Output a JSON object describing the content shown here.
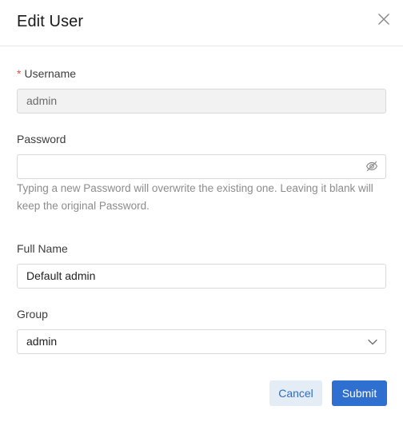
{
  "dialog": {
    "title": "Edit User"
  },
  "form": {
    "username": {
      "label": "Username",
      "required_mark": "*",
      "value": "admin"
    },
    "password": {
      "label": "Password",
      "value": "",
      "hint": "Typing a new Password will overwrite the existing one. Leaving it blank will keep the original Password."
    },
    "full_name": {
      "label": "Full Name",
      "value": "Default admin"
    },
    "group": {
      "label": "Group",
      "value": "admin"
    }
  },
  "buttons": {
    "cancel": "Cancel",
    "submit": "Submit"
  },
  "icons": {
    "close": "close-icon",
    "password_visibility": "eye-off-icon",
    "dropdown": "chevron-down-icon"
  },
  "colors": {
    "primary": "#2f6fcf",
    "cancel_bg": "#e4ecf6",
    "required": "#e34d4d",
    "hint": "#8c8c8c"
  }
}
